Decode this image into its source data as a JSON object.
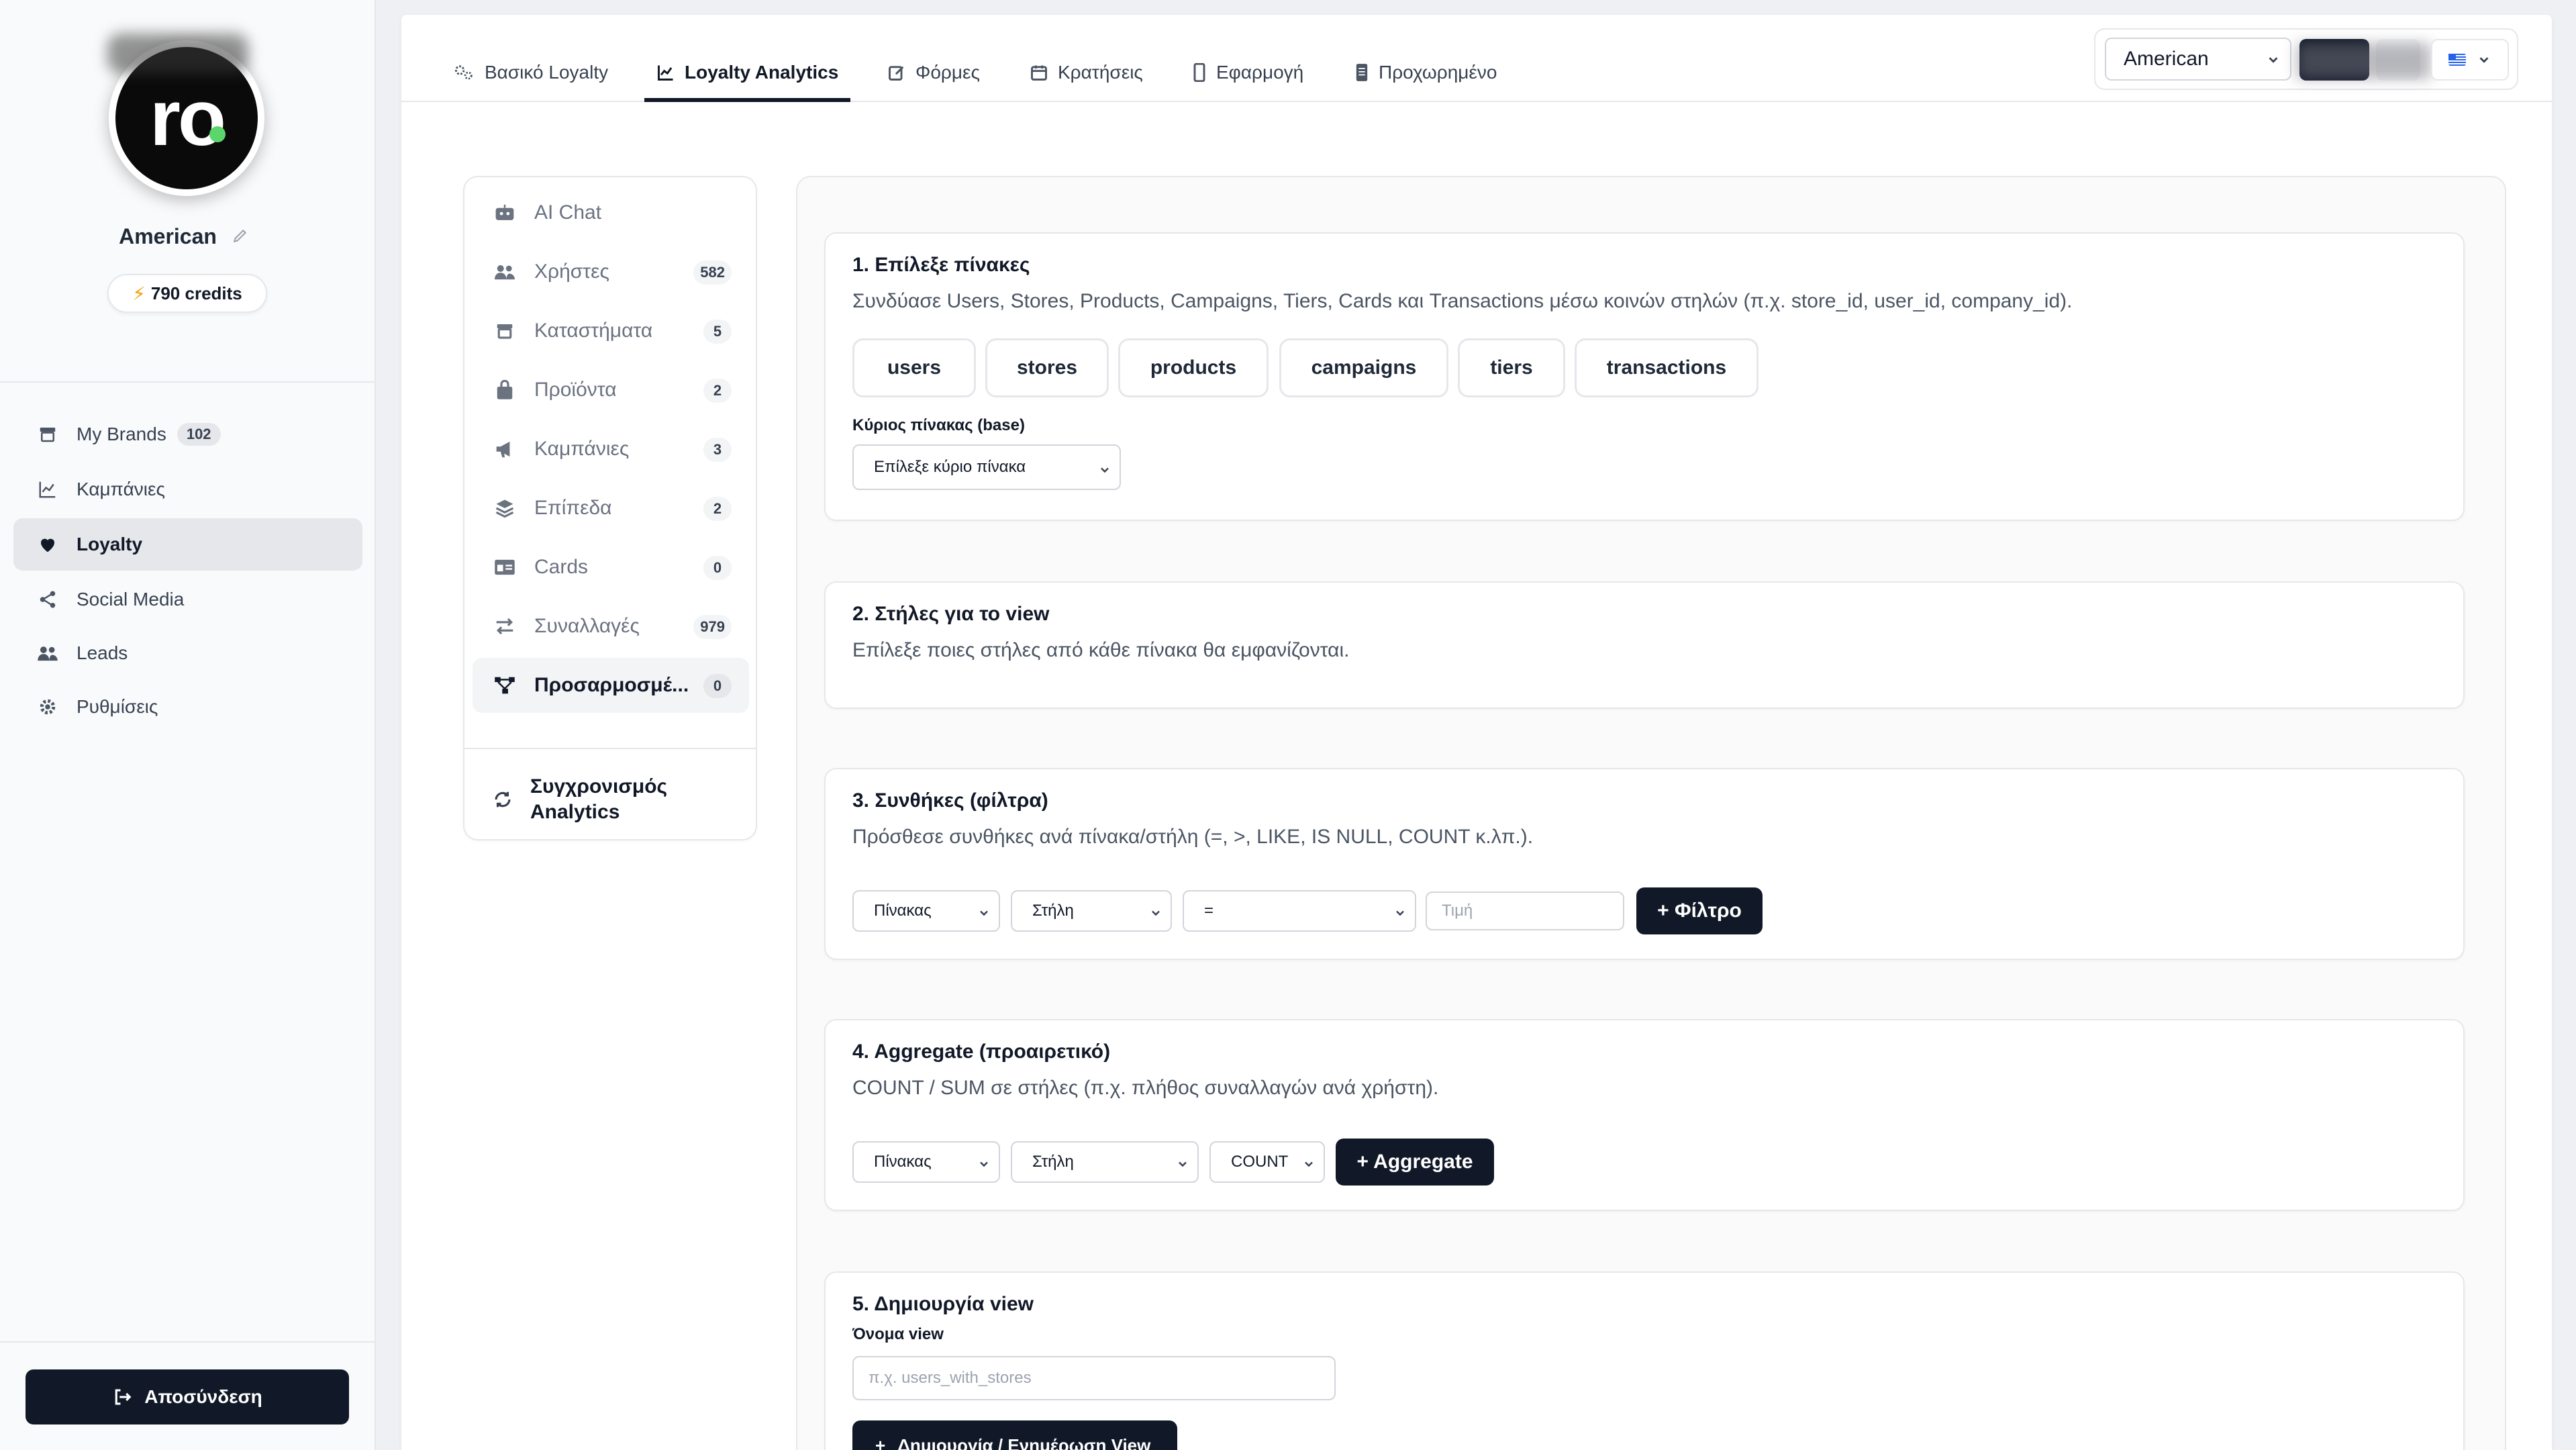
{
  "sidebar": {
    "avatar_text": "ro",
    "brand_name": "American",
    "credits": "790 credits",
    "nav": [
      {
        "label": "My Brands",
        "badge": "102"
      },
      {
        "label": "Καμπάνιες",
        "badge": ""
      },
      {
        "label": "Loyalty",
        "badge": ""
      },
      {
        "label": "Social Media",
        "badge": ""
      },
      {
        "label": "Leads",
        "badge": ""
      },
      {
        "label": "Ρυθμίσεις",
        "badge": ""
      }
    ],
    "logout_label": "Αποσύνδεση"
  },
  "topbar": {
    "tabs": [
      {
        "label": "Βασικό Loyalty"
      },
      {
        "label": "Loyalty Analytics"
      },
      {
        "label": "Φόρμες"
      },
      {
        "label": "Κρατήσεις"
      },
      {
        "label": "Εφαρμογή"
      },
      {
        "label": "Προχωρημένο"
      }
    ],
    "brand_select_value": "American"
  },
  "analytics_nav": {
    "items": [
      {
        "label": "AI Chat",
        "count": ""
      },
      {
        "label": "Χρήστες",
        "count": "582"
      },
      {
        "label": "Καταστήματα",
        "count": "5"
      },
      {
        "label": "Προϊόντα",
        "count": "2"
      },
      {
        "label": "Καμπάνιες",
        "count": "3"
      },
      {
        "label": "Επίπεδα",
        "count": "2"
      },
      {
        "label": "Cards",
        "count": "0"
      },
      {
        "label": "Συναλλαγές",
        "count": "979"
      },
      {
        "label": "Προσαρμοσμέ...",
        "count": "0"
      }
    ],
    "sync_label_line1": "Συγχρονισμός",
    "sync_label_line2": "Analytics"
  },
  "builder": {
    "step1": {
      "title": "1. Επίλεξε πίνακες",
      "desc": "Συνδύασε Users, Stores, Products, Campaigns, Tiers, Cards και Transactions μέσω κοινών στηλών (π.χ. store_id, user_id, company_id).",
      "tables": [
        "users",
        "stores",
        "products",
        "campaigns",
        "tiers",
        "transactions"
      ],
      "base_label": "Κύριος πίνακας (base)",
      "base_select": "Επίλεξε κύριο πίνακα"
    },
    "step2": {
      "title": "2. Στήλες για το view",
      "desc": "Επίλεξε ποιες στήλες από κάθε πίνακα θα εμφανίζονται."
    },
    "step3": {
      "title": "3. Συνθήκες (φίλτρα)",
      "desc": "Πρόσθεσε συνθήκες ανά πίνακα/στήλη (=, >, LIKE, IS NULL, COUNT κ.λπ.).",
      "table_select": "Πίνακας",
      "column_select": "Στήλη",
      "operator_select": "=",
      "value_placeholder": "Τιμή",
      "add_button": "+ Φίλτρο"
    },
    "step4": {
      "title": "4. Aggregate (προαιρετικό)",
      "desc": "COUNT / SUM σε στήλες (π.χ. πλήθος συναλλαγών ανά χρήστη).",
      "table_select": "Πίνακας",
      "column_select": "Στήλη",
      "func_select": "COUNT",
      "add_button": "+ Aggregate"
    },
    "step5": {
      "title": "5. Δημιουργία view",
      "name_label": "Όνομα view",
      "name_placeholder": "π.χ. users_with_stores",
      "create_button": "Δημιουργία / Ενημέρωση View"
    }
  },
  "colors": {
    "primary_dark": "#111827",
    "accent_green": "#5bd66c",
    "credits_bolt": "#f59e0b"
  }
}
